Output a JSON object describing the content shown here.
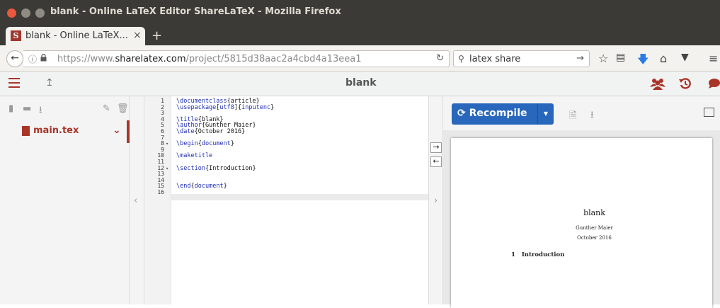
{
  "window": {
    "title": "blank - Online LaTeX Editor ShareLaTeX - Mozilla Firefox"
  },
  "browser": {
    "tab_label": "blank - Online LaTeX...",
    "tab_icon_letter": "S",
    "tab_close": "×",
    "new_tab": "+",
    "url_prefix": "https://www.",
    "url_domain": "sharelatex.com",
    "url_path": "/project/5815d38aac2a4cbd4a13eea1",
    "search_text": "latex share"
  },
  "app": {
    "project_title": "blank",
    "file_name": "main.tex",
    "recompile_label": "Recompile",
    "accent": "#a93529",
    "primary": "#2867bb"
  },
  "editor": {
    "line_numbers": [
      "1",
      "2",
      "3",
      "4",
      "5",
      "6",
      "7",
      "8",
      "9",
      "10",
      "11",
      "12",
      "13",
      "14",
      "15",
      "16"
    ],
    "fold_markers": {
      "8": "▾",
      "12": "▾"
    },
    "lines": [
      {
        "cmd": "\\documentclass",
        "arg": "{article}"
      },
      {
        "cmd": "\\usepackage",
        "arg": "[utf8]{inputenc}"
      },
      {
        "cmd": "",
        "arg": ""
      },
      {
        "cmd": "\\title",
        "arg": "{blank}"
      },
      {
        "cmd": "\\author",
        "arg": "{Gunther Maier}"
      },
      {
        "cmd": "\\date",
        "arg": "{October 2016}"
      },
      {
        "cmd": "",
        "arg": ""
      },
      {
        "cmd": "\\begin",
        "arg": "{document}"
      },
      {
        "cmd": "",
        "arg": ""
      },
      {
        "cmd": "\\maketitle",
        "arg": ""
      },
      {
        "cmd": "",
        "arg": ""
      },
      {
        "cmd": "\\section",
        "arg": "{Introduction}"
      },
      {
        "cmd": "",
        "arg": ""
      },
      {
        "cmd": "",
        "arg": ""
      },
      {
        "cmd": "\\end",
        "arg": "{document}"
      },
      {
        "cmd": "",
        "arg": ""
      }
    ]
  },
  "pdf": {
    "title": "blank",
    "author": "Gunther Maier",
    "date": "October 2016",
    "section_number": "1",
    "section_title": "Introduction"
  }
}
